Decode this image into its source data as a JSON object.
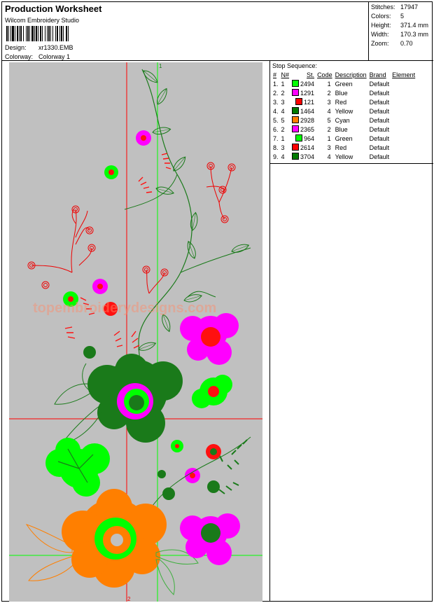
{
  "header": {
    "title": "Production Worksheet",
    "company": "Wilcom Embroidery Studio",
    "design_label": "Design:",
    "design_value": "xr1330.EMB",
    "colorway_label": "Colorway:",
    "colorway_value": "Colorway 1"
  },
  "stats": [
    {
      "label": "Stitches:",
      "value": "17947"
    },
    {
      "label": "Colors:",
      "value": "5"
    },
    {
      "label": "Height:",
      "value": "371.4 mm"
    },
    {
      "label": "Width:",
      "value": "170.3 mm"
    },
    {
      "label": "Zoom:",
      "value": "0.70"
    }
  ],
  "canvas": {
    "watermark": "topembroiderydesigns.com",
    "marker_top": "1",
    "marker_bottom": "2",
    "background": "#c0c0c0"
  },
  "stop_sequence": {
    "title": "Stop Sequence:",
    "columns": {
      "num": "#",
      "n": "N#",
      "st": "St.",
      "code": "Code",
      "description": "Description",
      "brand": "Brand",
      "element": "Element"
    },
    "rows": [
      {
        "num": "1.",
        "n": "1",
        "color": "#00ff00",
        "st": "2494",
        "code": "1",
        "description": "Green",
        "brand": "Default",
        "element": ""
      },
      {
        "num": "2.",
        "n": "2",
        "color": "#ff00ff",
        "st": "1291",
        "code": "2",
        "description": "Blue",
        "brand": "Default",
        "element": ""
      },
      {
        "num": "3.",
        "n": "3",
        "color": "#ff0000",
        "st": "121",
        "code": "3",
        "description": "Red",
        "brand": "Default",
        "element": ""
      },
      {
        "num": "4.",
        "n": "4",
        "color": "#007a00",
        "st": "1464",
        "code": "4",
        "description": "Yellow",
        "brand": "Default",
        "element": ""
      },
      {
        "num": "5.",
        "n": "5",
        "color": "#ff7f00",
        "st": "2928",
        "code": "5",
        "description": "Cyan",
        "brand": "Default",
        "element": ""
      },
      {
        "num": "6.",
        "n": "2",
        "color": "#ff00ff",
        "st": "2365",
        "code": "2",
        "description": "Blue",
        "brand": "Default",
        "element": ""
      },
      {
        "num": "7.",
        "n": "1",
        "color": "#00ff00",
        "st": "964",
        "code": "1",
        "description": "Green",
        "brand": "Default",
        "element": ""
      },
      {
        "num": "8.",
        "n": "3",
        "color": "#ff0000",
        "st": "2614",
        "code": "3",
        "description": "Red",
        "brand": "Default",
        "element": ""
      },
      {
        "num": "9.",
        "n": "4",
        "color": "#007a00",
        "st": "3704",
        "code": "4",
        "description": "Yellow",
        "brand": "Default",
        "element": ""
      }
    ]
  }
}
